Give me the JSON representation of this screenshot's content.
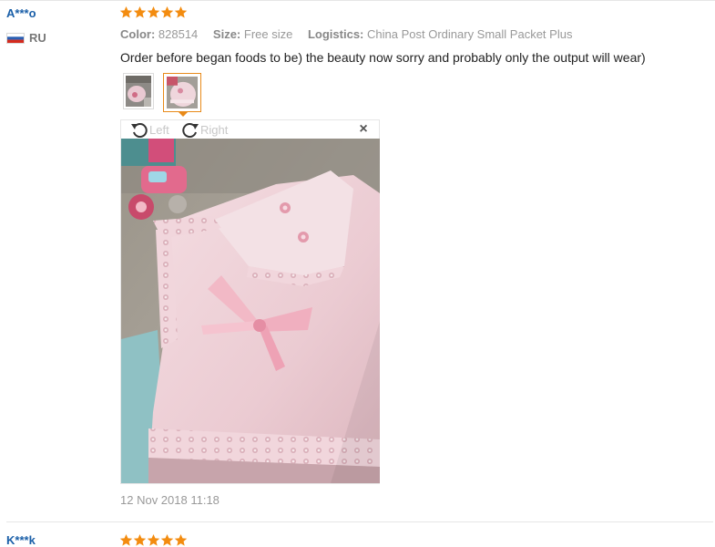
{
  "review": {
    "user": "A***o",
    "country_code": "RU",
    "rating": 5,
    "color_label": "Color:",
    "color_value": "828514",
    "size_label": "Size:",
    "size_value": "Free size",
    "logistics_label": "Logistics:",
    "logistics_value": "China Post Ordinary Small Packet Plus",
    "text": "Order before began foods to be) the beauty now sorry and probably only the output will wear)",
    "viewer": {
      "rotate_left_label": "Left",
      "rotate_right_label": "Right",
      "close_glyph": "×"
    },
    "timestamp": "12 Nov 2018 11:18"
  },
  "next_review": {
    "user": "K***k",
    "rating": 5
  },
  "colors": {
    "username": "#1a5fa8",
    "star": "#f38c10",
    "thumb_active_border": "#e88a1a",
    "muted_text": "#999999"
  },
  "icons": [
    "star-icon",
    "flag-ru-icon",
    "rotate-left-icon",
    "rotate-right-icon",
    "close-icon"
  ]
}
